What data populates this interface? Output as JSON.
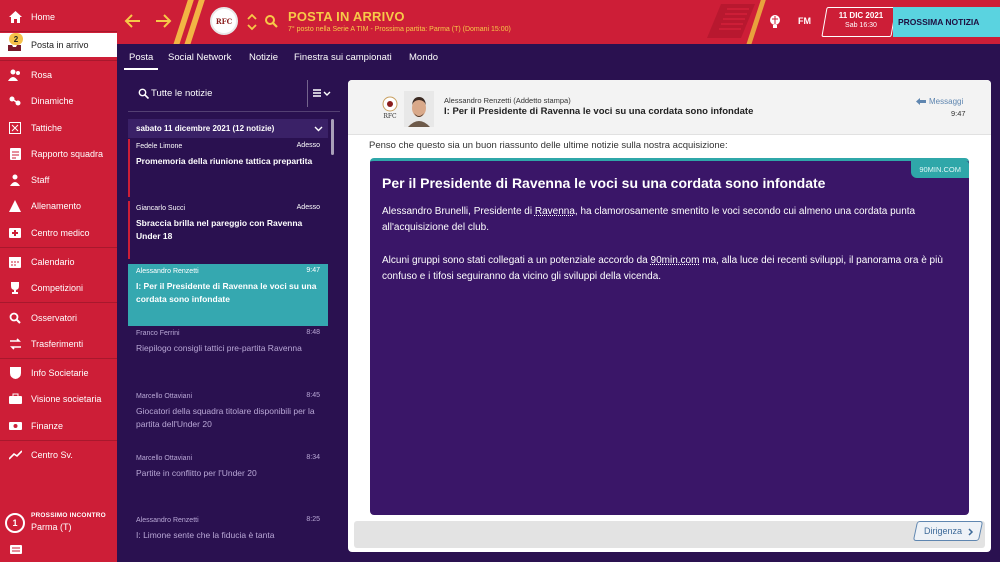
{
  "sidebar": {
    "items": [
      {
        "label": "Home",
        "icon": "home-icon"
      },
      {
        "label": "Posta in arrivo",
        "icon": "inbox-icon",
        "badge": "2"
      },
      {
        "label": "Rosa",
        "icon": "squad-icon"
      },
      {
        "label": "Dinamiche",
        "icon": "dynamics-icon"
      },
      {
        "label": "Tattiche",
        "icon": "tactics-icon"
      },
      {
        "label": "Rapporto squadra",
        "icon": "report-icon"
      },
      {
        "label": "Staff",
        "icon": "staff-icon"
      },
      {
        "label": "Allenamento",
        "icon": "training-icon"
      },
      {
        "label": "Centro medico",
        "icon": "medical-icon"
      },
      {
        "label": "Calendario",
        "icon": "calendar-icon"
      },
      {
        "label": "Competizioni",
        "icon": "trophy-icon"
      },
      {
        "label": "Osservatori",
        "icon": "scouting-icon"
      },
      {
        "label": "Trasferimenti",
        "icon": "transfers-icon"
      },
      {
        "label": "Info Societarie",
        "icon": "club-info-icon"
      },
      {
        "label": "Visione societaria",
        "icon": "club-vision-icon"
      },
      {
        "label": "Finanze",
        "icon": "finances-icon"
      },
      {
        "label": "Centro Sv.",
        "icon": "dev-centre-icon"
      }
    ],
    "next_match": {
      "label": "PROSSIMO INCONTRO",
      "opponent": "Parma (T)",
      "number": "1"
    }
  },
  "header": {
    "title": "POSTA IN ARRIVO",
    "subtitle": "7° posto nella Serie A TIM - Prossima partita: Parma (T) (Domani 15:00)",
    "club_logo_text": "RFC",
    "brand": "FM",
    "date": "11 DIC 2021",
    "time": "Sab 16:30",
    "next_button": "PROSSIMA NOTIZIA"
  },
  "tabs": [
    "Posta",
    "Social Network",
    "Notizie",
    "Finestra sui campionati",
    "Mondo"
  ],
  "list": {
    "search_label": "Tutte le notizie",
    "date_header": "sabato 11 dicembre 2021 (12 notizie)",
    "items": [
      {
        "sender": "Fedele Limone",
        "time": "Adesso",
        "subject": "Promemoria della riunione tattica prepartita"
      },
      {
        "sender": "Giancarlo Succi",
        "time": "Adesso",
        "subject": "Sbraccia brilla nel pareggio con Ravenna Under 18"
      },
      {
        "sender": "Alessandro Renzetti",
        "time": "9:47",
        "subject": "I: Per il Presidente di Ravenna le voci su una cordata sono infondate"
      },
      {
        "sender": "Franco Ferrini",
        "time": "8:48",
        "subject": "Riepilogo consigli tattici pre-partita Ravenna"
      },
      {
        "sender": "Marcello Ottaviani",
        "time": "8:45",
        "subject": "Giocatori della squadra titolare disponibili per la partita dell'Under 20"
      },
      {
        "sender": "Marcello Ottaviani",
        "time": "8:34",
        "subject": "Partite in conflitto per l'Under 20"
      },
      {
        "sender": "Alessandro Renzetti",
        "time": "8:25",
        "subject": "I: Limone sente che la fiducia è tanta"
      }
    ]
  },
  "message": {
    "from": "Alessandro Renzetti  (Addetto stampa)",
    "subject": "I: Per il Presidente di Ravenna le voci su una cordata sono infondate",
    "type_label": "Messaggi",
    "time": "9:47",
    "club_logo_text": "RFC",
    "intro": "Penso che questo sia un buon riassunto delle ultime notizie sulla nostra acquisizione:",
    "article": {
      "source": "90MIN.COM",
      "title": "Per il Presidente di Ravenna le voci su una cordata sono infondate",
      "p1_a": "Alessandro Brunelli, Presidente di ",
      "p1_link": "Ravenna",
      "p1_b": ", ha clamorosamente smentito le voci secondo cui almeno una cordata punta all'acquisizione del club.",
      "p2_a": "Alcuni gruppi sono stati collegati a un potenziale accordo da ",
      "p2_link": "90min.com",
      "p2_b": " ma, alla luce dei recenti sviluppi, il panorama ora è più confuso e i tifosi seguiranno da vicino gli sviluppi della vicenda."
    },
    "footer_button": "Dirigenza"
  }
}
